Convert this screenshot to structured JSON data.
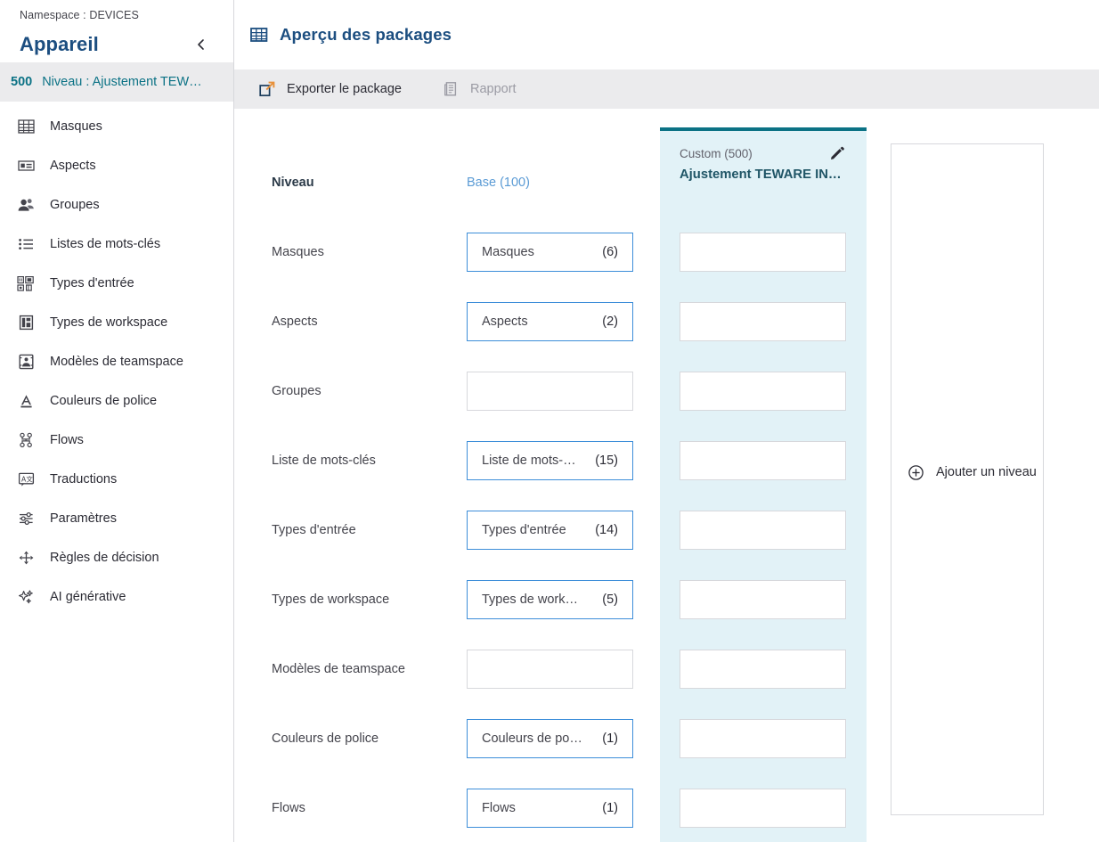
{
  "sidebar": {
    "namespace_label": "Namespace : DEVICES",
    "title": "Appareil",
    "collapse_icon": "chevron-left-icon",
    "active_item": {
      "number": "500",
      "label": "Niveau : Ajustement TEW…"
    },
    "items": [
      {
        "label": "Masques",
        "icon": "table-icon"
      },
      {
        "label": "Aspects",
        "icon": "card-icon"
      },
      {
        "label": "Groupes",
        "icon": "people-icon"
      },
      {
        "label": "Listes de mots-clés",
        "icon": "list-icon"
      },
      {
        "label": "Types d'entrée",
        "icon": "entry-types-icon"
      },
      {
        "label": "Types de workspace",
        "icon": "workspace-types-icon"
      },
      {
        "label": "Modèles de teamspace",
        "icon": "teamspace-template-icon"
      },
      {
        "label": "Couleurs de police",
        "icon": "font-color-icon"
      },
      {
        "label": "Flows",
        "icon": "flow-icon"
      },
      {
        "label": "Traductions",
        "icon": "translate-icon"
      },
      {
        "label": "Paramètres",
        "icon": "sliders-icon"
      },
      {
        "label": "Règles de décision",
        "icon": "decision-rules-icon"
      },
      {
        "label": "AI générative",
        "icon": "sparkle-icon"
      }
    ]
  },
  "header": {
    "icon": "table-grid-icon",
    "title": "Aperçu des packages"
  },
  "toolbar": {
    "export_label": "Exporter le package",
    "export_icon": "external-link-icon",
    "report_label": "Rapport",
    "report_icon": "document-icon",
    "report_disabled": true
  },
  "grid": {
    "row_header_label": "Niveau",
    "base_column_label": "Base (100)",
    "custom_column": {
      "subtitle": "Custom (500)",
      "title": "Ajustement TEWARE IN…",
      "edit_icon": "pencil-icon"
    },
    "add_column": {
      "label": "Ajouter un niveau",
      "icon": "plus-circle-icon"
    },
    "rows": [
      {
        "label": "Masques",
        "base_name": "Masques",
        "base_count": "(6)"
      },
      {
        "label": "Aspects",
        "base_name": "Aspects",
        "base_count": "(2)"
      },
      {
        "label": "Groupes",
        "base_name": "",
        "base_count": ""
      },
      {
        "label": "Liste de mots-clés",
        "base_name": "Liste de mots-…",
        "base_count": "(15)"
      },
      {
        "label": "Types d'entrée",
        "base_name": "Types d'entrée",
        "base_count": "(14)"
      },
      {
        "label": "Types de workspace",
        "base_name": "Types de work…",
        "base_count": "(5)"
      },
      {
        "label": "Modèles de teamspace",
        "base_name": "",
        "base_count": ""
      },
      {
        "label": "Couleurs de police",
        "base_name": "Couleurs de po…",
        "base_count": "(1)"
      },
      {
        "label": "Flows",
        "base_name": "Flows",
        "base_count": "(1)"
      }
    ]
  },
  "colors": {
    "brand_blue": "#1c4e80",
    "teal": "#0b7285",
    "custom_column_bg": "#e2f2f7",
    "toolbar_bg": "#ebebed",
    "cell_border_blue": "#3d8ed9",
    "cell_border_gray": "#d7d8dc",
    "base_link": "#5b9bd5"
  }
}
